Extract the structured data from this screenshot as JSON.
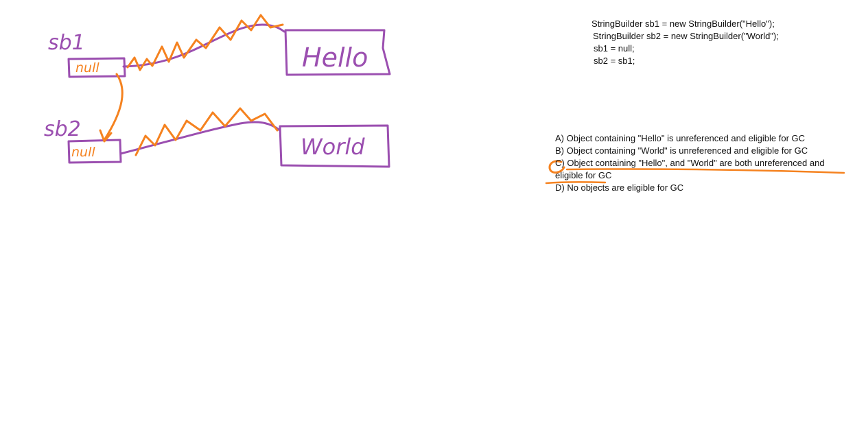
{
  "sketch": {
    "var1_label": "sb1",
    "var2_label": "sb2",
    "var1_value": "null",
    "var2_value": "null",
    "object1_label": "Hello",
    "object2_label": "World",
    "colors": {
      "ink_purple": "#9b4fb0",
      "ink_orange": "#f5821f"
    }
  },
  "code": {
    "lines": [
      "StringBuilder sb1 = new StringBuilder(\"Hello\");",
      "StringBuilder sb2 = new StringBuilder(\"World\");",
      "sb1 = null;",
      "sb2 = sb1;"
    ]
  },
  "question": {
    "options": [
      "A) Object containing \"Hello\" is unreferenced and eligible for GC",
      "B) Object containing \"World\" is unreferenced and eligible for GC",
      "C) Object containing \"Hello\", and \"World\" are both unreferenced and eligible for GC",
      "D) No objects are eligible for GC"
    ],
    "selected": "C"
  }
}
